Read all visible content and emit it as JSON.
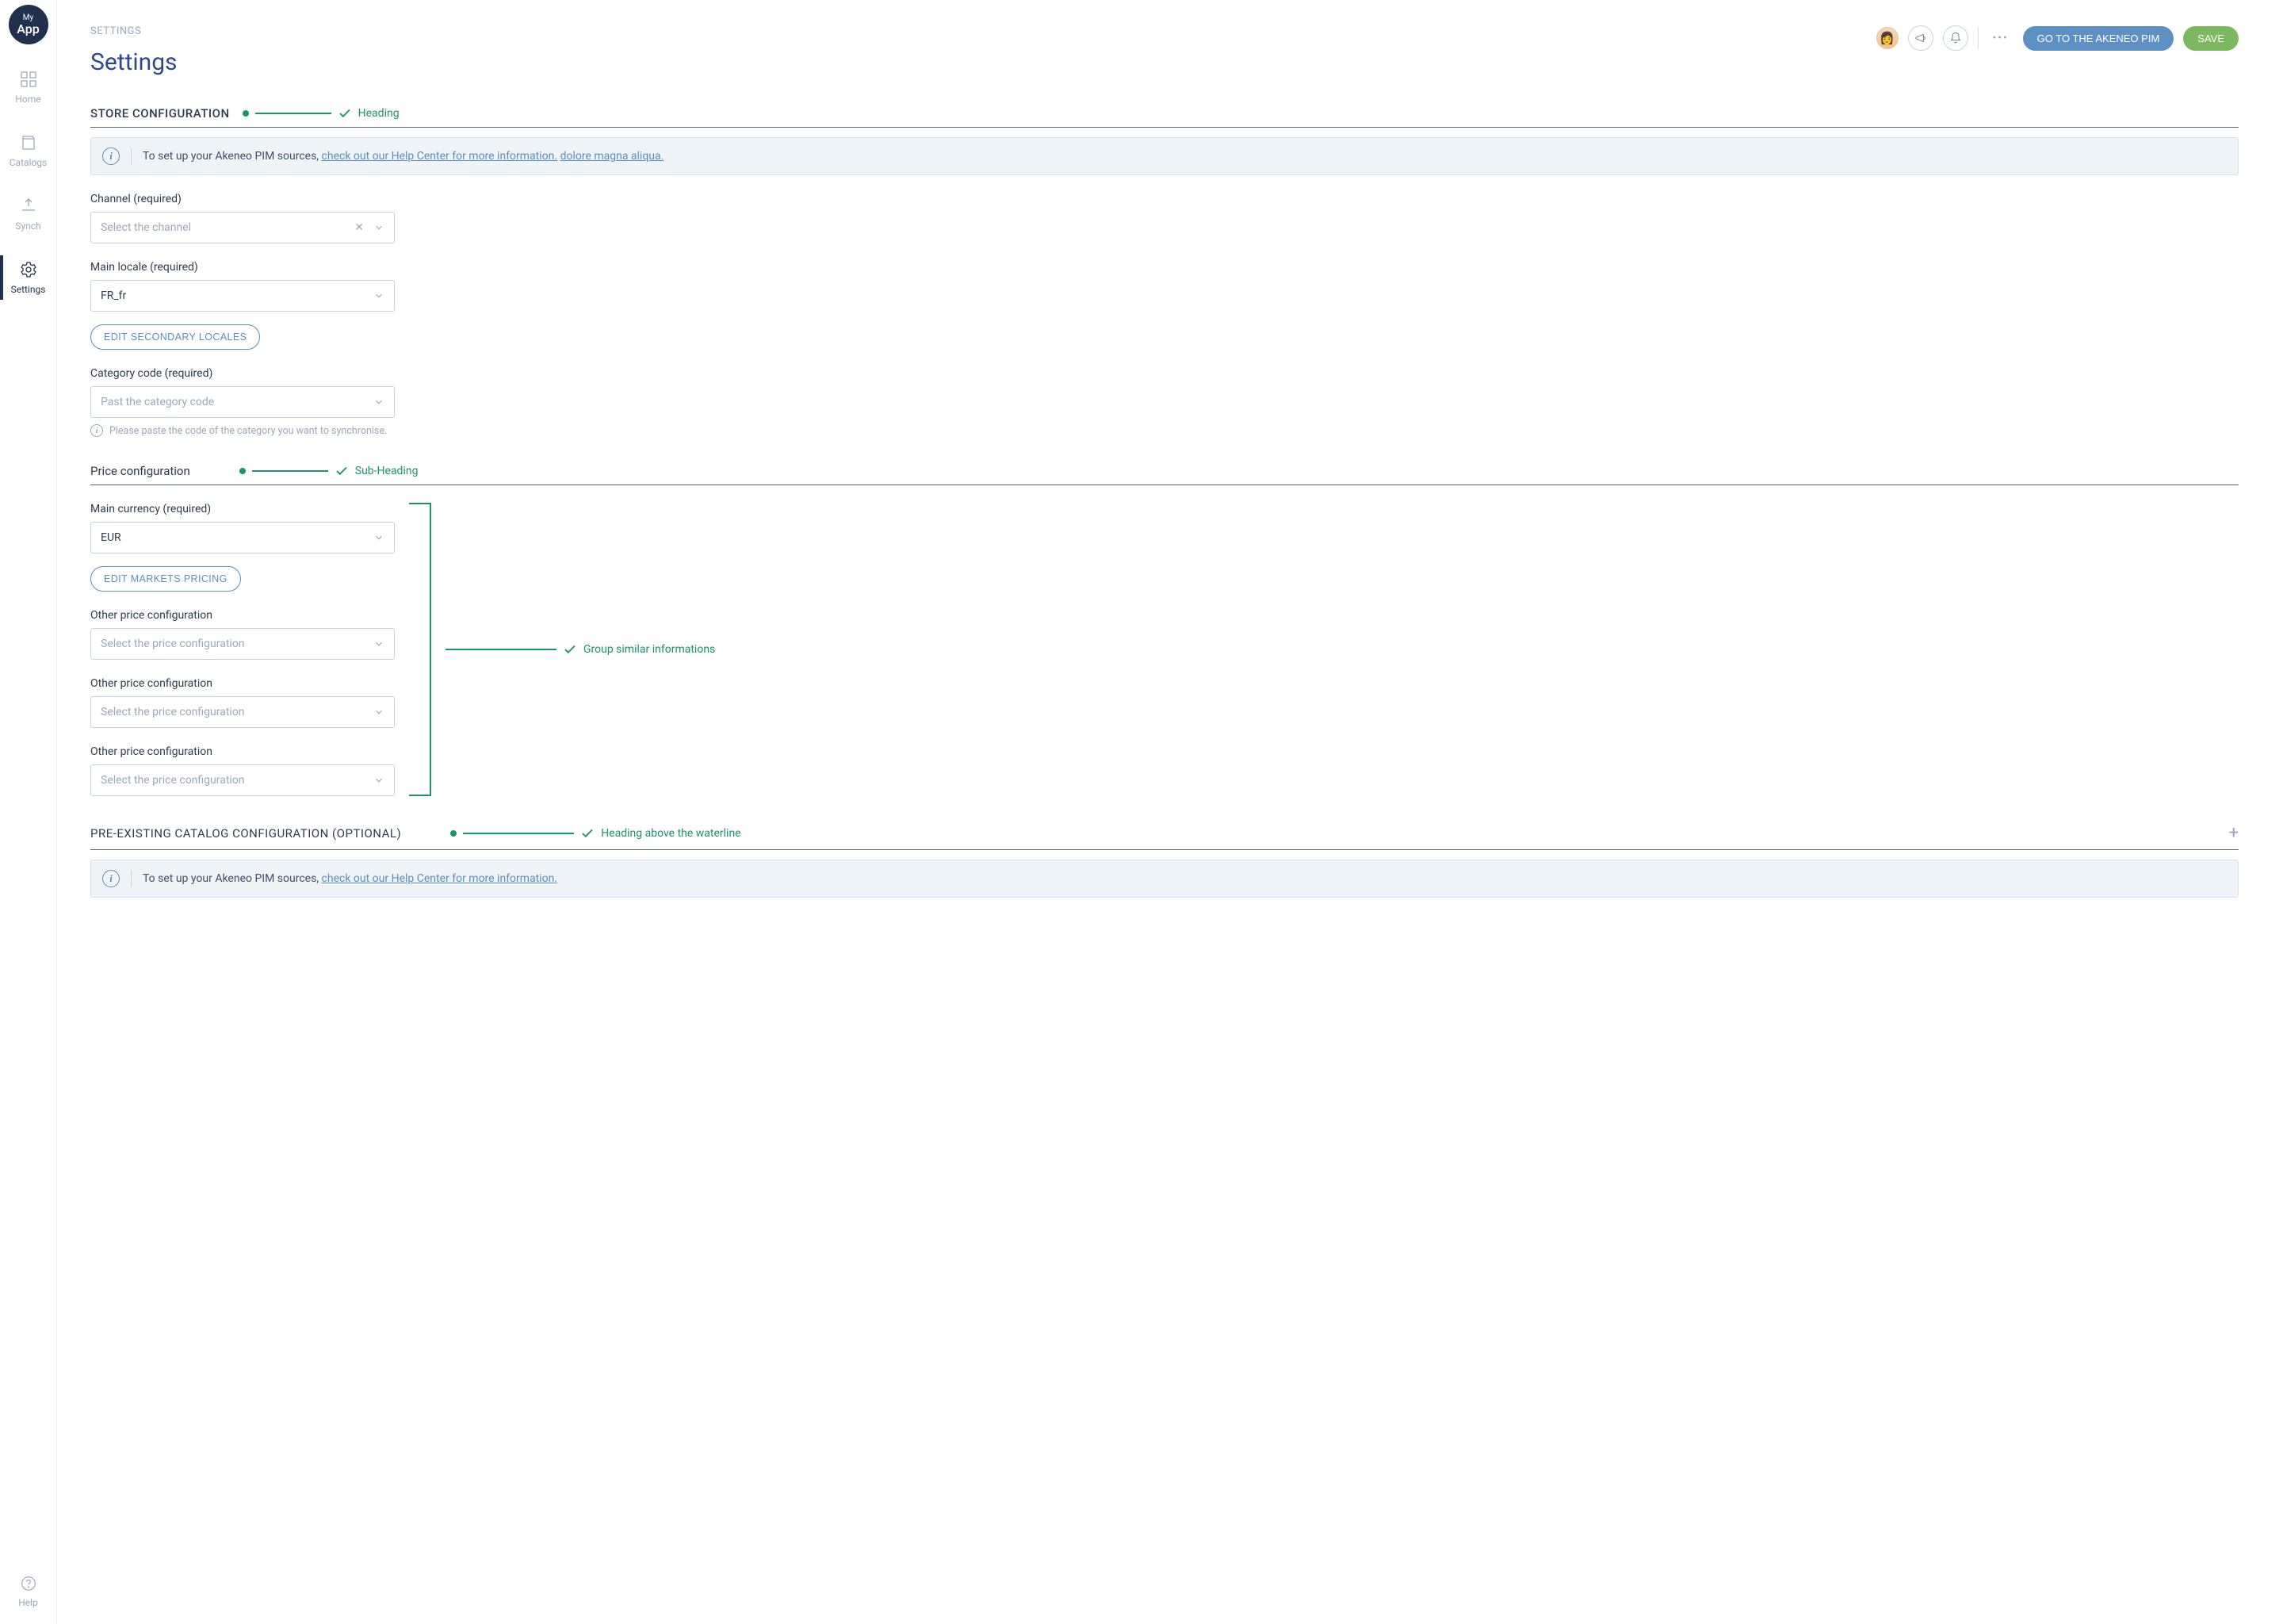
{
  "brand": {
    "top": "My",
    "bot": "App"
  },
  "sidebar": {
    "items": [
      {
        "label": "Home"
      },
      {
        "label": "Catalogs"
      },
      {
        "label": "Synch"
      },
      {
        "label": "Settings"
      }
    ],
    "help": "Help"
  },
  "breadcrumb": "SETTINGS",
  "page_title": "Settings",
  "top_actions": {
    "go_to_pim": "GO TO THE AKENEO PIM",
    "save": "SAVE"
  },
  "callouts": {
    "heading": "Heading",
    "subheading": "Sub-Heading",
    "group": "Group similar informations",
    "waterline": "Heading above the waterline"
  },
  "store_config": {
    "heading": "STORE CONFIGURATION",
    "banner_prefix": "To set up your Akeneo PIM sources, ",
    "banner_link1": "check out our Help Center for more information.",
    "banner_link2": "dolore magna aliqua.",
    "channel_label": "Channel (required)",
    "channel_placeholder": "Select the channel",
    "locale_label": "Main locale (required)",
    "locale_value": "FR_fr",
    "edit_locales_btn": "EDIT SECONDARY LOCALES",
    "category_label": "Category code (required)",
    "category_placeholder": "Past the category code",
    "category_helper": "Please paste the code of the category you want to synchronise."
  },
  "price_config": {
    "heading": "Price configuration",
    "currency_label": "Main currency (required)",
    "currency_value": "EUR",
    "edit_pricing_btn": "EDIT MARKETS PRICING",
    "other_label": "Other price configuration",
    "other_placeholder": "Select the price configuration"
  },
  "pre_existing": {
    "heading": "PRE-EXISTING CATALOG CONFIGURATION (OPTIONAL)",
    "banner_prefix": "To set up your Akeneo PIM sources, ",
    "banner_link": "check out our Help Center for more information."
  }
}
